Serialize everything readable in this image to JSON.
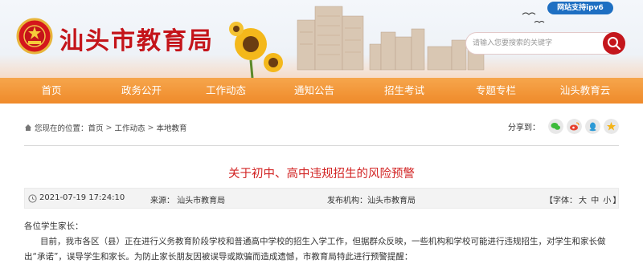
{
  "header": {
    "ipv6_badge": "网站支持ipv6",
    "site_title": "汕头市教育局",
    "search_placeholder": "请输入您要搜索的关键字"
  },
  "nav": {
    "items": [
      {
        "label": "首页"
      },
      {
        "label": "政务公开"
      },
      {
        "label": "工作动态"
      },
      {
        "label": "通知公告"
      },
      {
        "label": "招生考试"
      },
      {
        "label": "专题专栏"
      },
      {
        "label": "汕头教育云"
      }
    ]
  },
  "breadcrumb": {
    "prefix": "您现在的位置：",
    "items": [
      "首页",
      "工作动态",
      "本地教育"
    ],
    "separator": ">"
  },
  "share": {
    "label": "分享到：",
    "icons": [
      "wechat-icon",
      "weibo-icon",
      "qq-icon",
      "qzone-icon"
    ]
  },
  "article": {
    "title": "关于初中、高中违规招生的风险预警",
    "datetime": "2021-07-19 17:24:10",
    "source": "来源： 汕头市教育局",
    "publisher": "发布机构：汕头市教育局",
    "font_size": {
      "open": "【字体：",
      "large": "大",
      "medium": "中",
      "small": "小",
      "close": "】"
    },
    "salutation": "各位学生家长：",
    "paragraph_1": "目前，我市各区（县）正在进行义务教育阶段学校和普通高中学校的招生入学工作，但据群众反映，一些机构和学校可能进行违规招生，对学生和家长做出“承诺”，误导学生和家长。为防止家长朋友因被误导或欺骗而造成遗憾，市教育局特此进行预警提醒："
  },
  "colors": {
    "brand_red": "#c4141a",
    "nav_orange": "#ef8a2a",
    "title_red": "#d22424"
  }
}
